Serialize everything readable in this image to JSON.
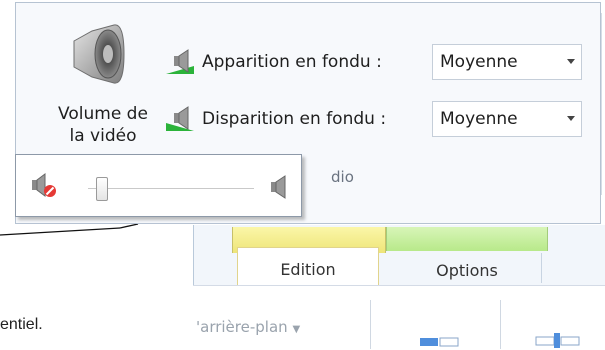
{
  "panel": {
    "volume_label_line1": "Volume de",
    "volume_label_line2": "la vidéo",
    "fade_in_label": "Apparition en fondu :",
    "fade_out_label": "Disparition en fondu :",
    "fade_in_value": "Moyenne",
    "fade_out_value": "Moyenne",
    "group_label_fragment": "dio"
  },
  "volume_slider": {
    "level": 0.05,
    "muted_icon": "speaker-muted-icon",
    "max_icon": "speaker-icon"
  },
  "background_ribbon": {
    "tabs": [
      {
        "label": "Edition",
        "selected": true
      },
      {
        "label": "Options",
        "selected": false
      }
    ],
    "partial_label": "'arrière-plan",
    "context_colors": {
      "yellow": "#eee578",
      "green": "#b8e98a"
    }
  },
  "body_text_fragment": "entiel."
}
